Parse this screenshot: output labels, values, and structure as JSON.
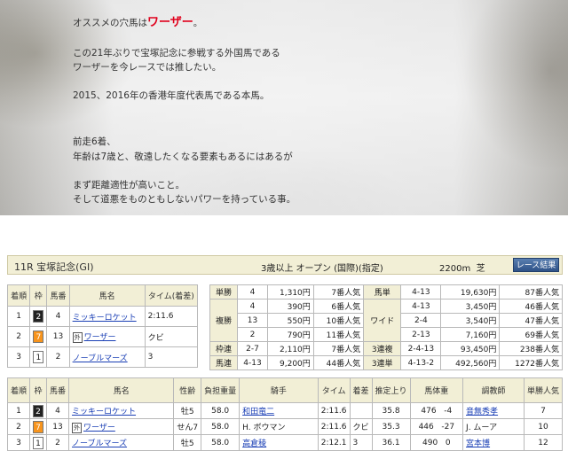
{
  "blog": {
    "line1_prefix": "オススメの穴馬は",
    "line1_horse": "ワーザー",
    "line1_suffix": "。",
    "line2": "この21年ぶりで宝塚記念に参戦する外国馬である",
    "line3": "ワーザーを今レースでは推したい。",
    "line4": "2015、2016年の香港年度代表馬である本馬。",
    "line5": "前走6着、",
    "line6": "年齢は7歳と、敬遠したくなる要素もあるにはあるが",
    "line7": "まず距離適性が高いこと。",
    "line8": "そして道悪をものともしないパワーを持っている事。"
  },
  "race": {
    "name": "11R 宝塚記念(GI)",
    "conditions": "3歳以上 オープン (国際)(指定)",
    "distance": "2200m",
    "surface": "芝",
    "button_label": "レース結果"
  },
  "top3": {
    "headers": [
      "着順",
      "枠",
      "馬番",
      "馬名",
      "タイム(着差)"
    ],
    "rows": [
      {
        "pos": "1",
        "waku": "2",
        "num": "4",
        "name": "ミッキーロケット",
        "time": "2:11.6"
      },
      {
        "pos": "2",
        "waku": "7",
        "num": "13",
        "gai": "外",
        "name": "ワーザー",
        "time": "クビ"
      },
      {
        "pos": "3",
        "waku": "1",
        "num": "2",
        "name": "ノーブルマーズ",
        "time": "3"
      }
    ]
  },
  "payouts": {
    "tansho": {
      "label": "単勝",
      "combo": "4",
      "amount": "1,310円",
      "pop": "7番人気"
    },
    "fukusho": {
      "label": "複勝",
      "rows": [
        {
          "combo": "4",
          "amount": "390円",
          "pop": "6番人気"
        },
        {
          "combo": "13",
          "amount": "550円",
          "pop": "10番人気"
        },
        {
          "combo": "2",
          "amount": "790円",
          "pop": "11番人気"
        }
      ]
    },
    "wakuren": {
      "label": "枠連",
      "combo": "2-7",
      "amount": "2,110円",
      "pop": "7番人気"
    },
    "umaren": {
      "label": "馬連",
      "combo": "4-13",
      "amount": "9,200円",
      "pop": "44番人気"
    },
    "umatan": {
      "label": "馬単",
      "combo": "4-13",
      "amount": "19,630円",
      "pop": "87番人気"
    },
    "wide": {
      "label": "ワイド",
      "rows": [
        {
          "combo": "4-13",
          "amount": "3,450円",
          "pop": "46番人気"
        },
        {
          "combo": "2-4",
          "amount": "3,540円",
          "pop": "47番人気"
        },
        {
          "combo": "2-13",
          "amount": "7,160円",
          "pop": "69番人気"
        }
      ]
    },
    "sanrenpuku": {
      "label": "3連複",
      "combo": "2-4-13",
      "amount": "93,450円",
      "pop": "238番人気"
    },
    "sanrentan": {
      "label": "3連単",
      "combo": "4-13-2",
      "amount": "492,560円",
      "pop": "1272番人気"
    }
  },
  "full": {
    "headers": [
      "着順",
      "枠",
      "馬番",
      "馬名",
      "性齢",
      "負担重量",
      "騎手",
      "タイム",
      "着差",
      "推定上り",
      "馬体重",
      "調教師",
      "単勝人気"
    ],
    "rows": [
      {
        "pos": "1",
        "waku": "2",
        "num": "4",
        "name": "ミッキーロケット",
        "sex": "牡5",
        "weight": "58.0",
        "jockey": "和田竜二",
        "time": "2:11.6",
        "margin": "",
        "agari": "35.8",
        "bw": "476",
        "diff": "-4",
        "trainer": "音無秀孝",
        "pop": "7"
      },
      {
        "pos": "2",
        "waku": "7",
        "num": "13",
        "gai": "外",
        "name": "ワーザー",
        "sex": "せん7",
        "weight": "58.0",
        "jockey": "H. ボウマン",
        "time": "2:11.6",
        "margin": "クビ",
        "agari": "35.3",
        "bw": "446",
        "diff": "-27",
        "trainer": "J. ムーア",
        "pop": "10"
      },
      {
        "pos": "3",
        "waku": "1",
        "num": "2",
        "name": "ノーブルマーズ",
        "sex": "牡5",
        "weight": "58.0",
        "jockey": "高倉稜",
        "time": "2:12.1",
        "margin": "3",
        "agari": "36.1",
        "bw": "490",
        "diff": "0",
        "trainer": "宮本博",
        "pop": "12"
      }
    ]
  }
}
